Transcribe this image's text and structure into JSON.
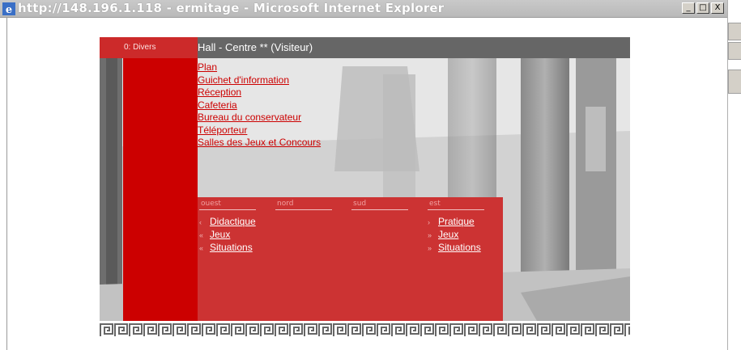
{
  "window": {
    "title": "http://148.196.1.118 - ermitage - Microsoft Internet Explorer",
    "minimize": "_",
    "maximize": "□",
    "close": "X"
  },
  "header": {
    "section": "0: Divers",
    "location": "Hall - Centre ** (Visiteur)"
  },
  "links": [
    "Plan",
    "Guichet d'information",
    "Réception",
    "Cafeteria",
    "Bureau du conservateur",
    "Téléporteur",
    "Salles des Jeux et Concours"
  ],
  "nav": {
    "ouest": {
      "label": "ouest",
      "items": [
        "Didactique",
        "Jeux",
        "Situations"
      ],
      "arrows": [
        "‹",
        "«",
        "«"
      ]
    },
    "nord": {
      "label": "nord"
    },
    "sud": {
      "label": "sud"
    },
    "est": {
      "label": "est",
      "items": [
        "Pratique",
        "Jeux",
        "Situations"
      ],
      "arrows": [
        "›",
        "»",
        "»"
      ]
    }
  },
  "colors": {
    "red": "#cc0000",
    "panel": "#cc3333",
    "bar": "#666666"
  }
}
